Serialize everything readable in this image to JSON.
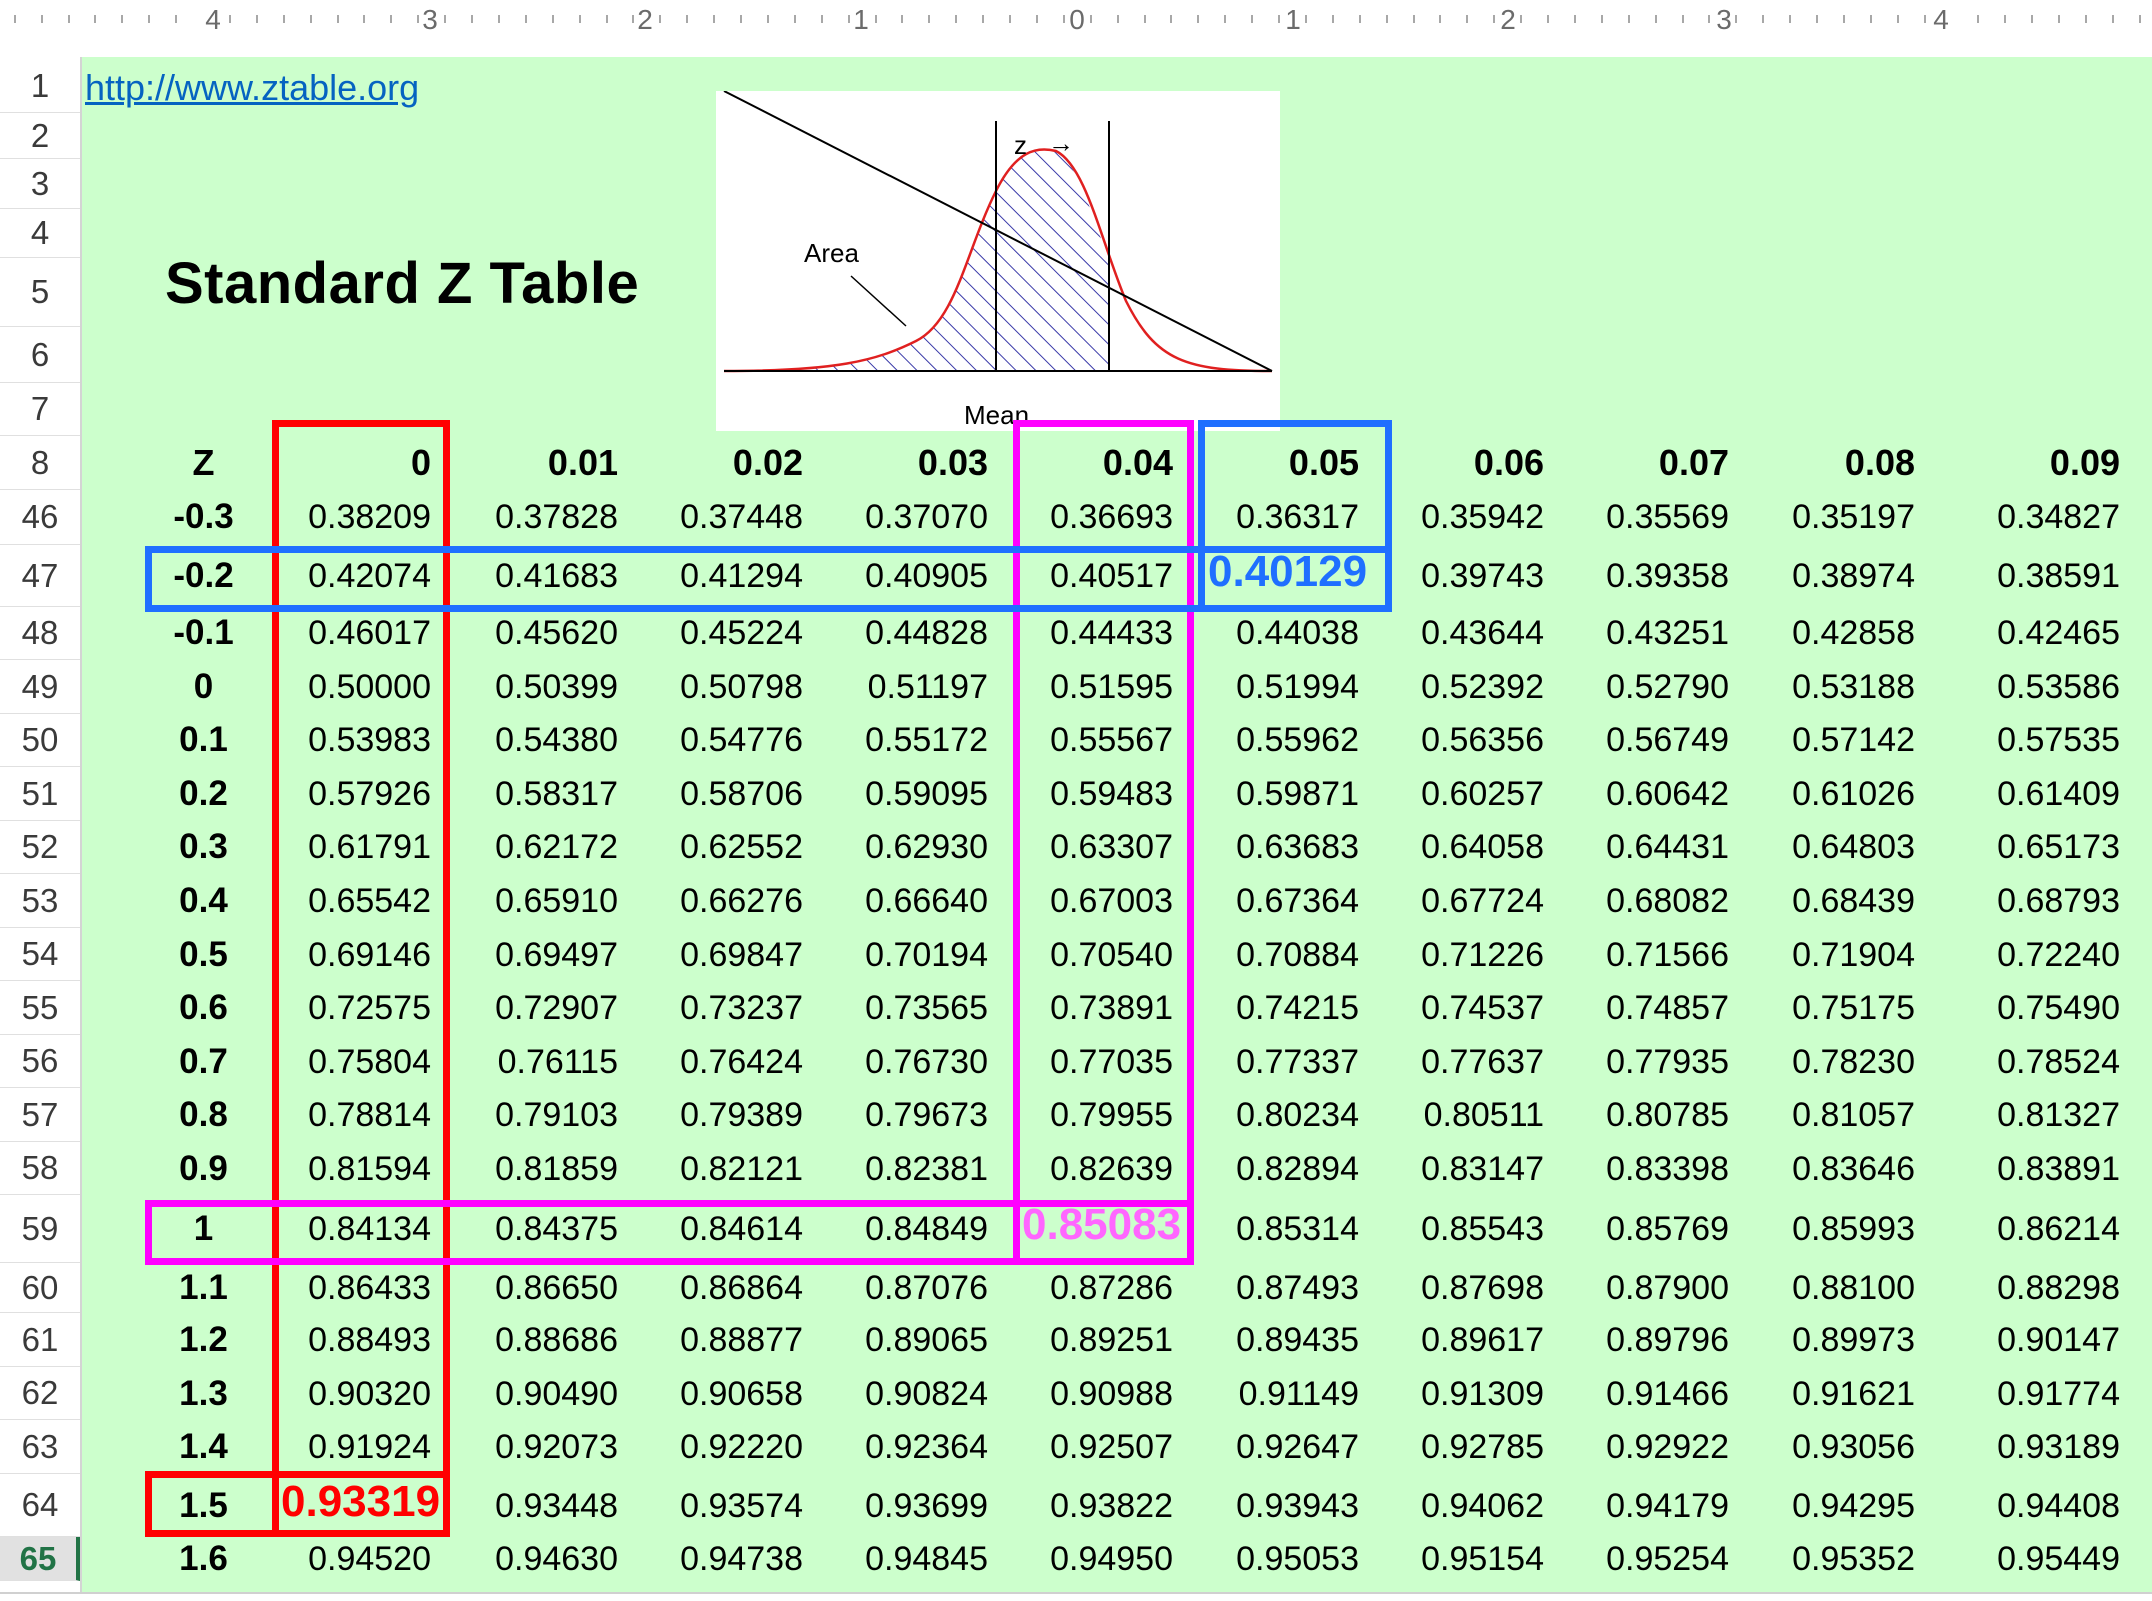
{
  "ruler": {
    "labels": [
      "4",
      "3",
      "2",
      "1",
      "0",
      "1",
      "2",
      "3",
      "4"
    ]
  },
  "link_text": "http://www.ztable.org",
  "title": "Standard Z Table",
  "figure": {
    "z_label": "z",
    "arrow": "→",
    "area_label": "Area",
    "mean_label": "Mean"
  },
  "colors": {
    "sheet_bg": "#ccffcc",
    "red_highlight": "#ff0000",
    "blue_highlight": "#1f6fff",
    "magenta_highlight": "#ff00ff",
    "pink_value": "#ff66ff",
    "link": "#0563c1"
  },
  "row_numbers": [
    "1",
    "2",
    "3",
    "4",
    "5",
    "6",
    "7",
    "8",
    "46",
    "47",
    "48",
    "49",
    "50",
    "51",
    "52",
    "53",
    "54",
    "55",
    "56",
    "57",
    "58",
    "59",
    "60",
    "61",
    "62",
    "63",
    "64",
    "65"
  ],
  "active_row": "65",
  "table": {
    "header_z": "Z",
    "columns": [
      "0",
      "0.01",
      "0.02",
      "0.03",
      "0.04",
      "0.05",
      "0.06",
      "0.07",
      "0.08",
      "0.09"
    ],
    "rows": [
      {
        "z": "-0.3",
        "values": [
          "0.38209",
          "0.37828",
          "0.37448",
          "0.37070",
          "0.36693",
          "0.36317",
          "0.35942",
          "0.35569",
          "0.35197",
          "0.34827"
        ]
      },
      {
        "z": "-0.2",
        "values": [
          "0.42074",
          "0.41683",
          "0.41294",
          "0.40905",
          "0.40517",
          "0.40129",
          "0.39743",
          "0.39358",
          "0.38974",
          "0.38591"
        ]
      },
      {
        "z": "-0.1",
        "values": [
          "0.46017",
          "0.45620",
          "0.45224",
          "0.44828",
          "0.44433",
          "0.44038",
          "0.43644",
          "0.43251",
          "0.42858",
          "0.42465"
        ]
      },
      {
        "z": "0",
        "values": [
          "0.50000",
          "0.50399",
          "0.50798",
          "0.51197",
          "0.51595",
          "0.51994",
          "0.52392",
          "0.52790",
          "0.53188",
          "0.53586"
        ]
      },
      {
        "z": "0.1",
        "values": [
          "0.53983",
          "0.54380",
          "0.54776",
          "0.55172",
          "0.55567",
          "0.55962",
          "0.56356",
          "0.56749",
          "0.57142",
          "0.57535"
        ]
      },
      {
        "z": "0.2",
        "values": [
          "0.57926",
          "0.58317",
          "0.58706",
          "0.59095",
          "0.59483",
          "0.59871",
          "0.60257",
          "0.60642",
          "0.61026",
          "0.61409"
        ]
      },
      {
        "z": "0.3",
        "values": [
          "0.61791",
          "0.62172",
          "0.62552",
          "0.62930",
          "0.63307",
          "0.63683",
          "0.64058",
          "0.64431",
          "0.64803",
          "0.65173"
        ]
      },
      {
        "z": "0.4",
        "values": [
          "0.65542",
          "0.65910",
          "0.66276",
          "0.66640",
          "0.67003",
          "0.67364",
          "0.67724",
          "0.68082",
          "0.68439",
          "0.68793"
        ]
      },
      {
        "z": "0.5",
        "values": [
          "0.69146",
          "0.69497",
          "0.69847",
          "0.70194",
          "0.70540",
          "0.70884",
          "0.71226",
          "0.71566",
          "0.71904",
          "0.72240"
        ]
      },
      {
        "z": "0.6",
        "values": [
          "0.72575",
          "0.72907",
          "0.73237",
          "0.73565",
          "0.73891",
          "0.74215",
          "0.74537",
          "0.74857",
          "0.75175",
          "0.75490"
        ]
      },
      {
        "z": "0.7",
        "values": [
          "0.75804",
          "0.76115",
          "0.76424",
          "0.76730",
          "0.77035",
          "0.77337",
          "0.77637",
          "0.77935",
          "0.78230",
          "0.78524"
        ]
      },
      {
        "z": "0.8",
        "values": [
          "0.78814",
          "0.79103",
          "0.79389",
          "0.79673",
          "0.79955",
          "0.80234",
          "0.80511",
          "0.80785",
          "0.81057",
          "0.81327"
        ]
      },
      {
        "z": "0.9",
        "values": [
          "0.81594",
          "0.81859",
          "0.82121",
          "0.82381",
          "0.82639",
          "0.82894",
          "0.83147",
          "0.83398",
          "0.83646",
          "0.83891"
        ]
      },
      {
        "z": "1",
        "values": [
          "0.84134",
          "0.84375",
          "0.84614",
          "0.84849",
          "0.85083",
          "0.85314",
          "0.85543",
          "0.85769",
          "0.85993",
          "0.86214"
        ]
      },
      {
        "z": "1.1",
        "values": [
          "0.86433",
          "0.86650",
          "0.86864",
          "0.87076",
          "0.87286",
          "0.87493",
          "0.87698",
          "0.87900",
          "0.88100",
          "0.88298"
        ]
      },
      {
        "z": "1.2",
        "values": [
          "0.88493",
          "0.88686",
          "0.88877",
          "0.89065",
          "0.89251",
          "0.89435",
          "0.89617",
          "0.89796",
          "0.89973",
          "0.90147"
        ]
      },
      {
        "z": "1.3",
        "values": [
          "0.90320",
          "0.90490",
          "0.90658",
          "0.90824",
          "0.90988",
          "0.91149",
          "0.91309",
          "0.91466",
          "0.91621",
          "0.91774"
        ]
      },
      {
        "z": "1.4",
        "values": [
          "0.91924",
          "0.92073",
          "0.92220",
          "0.92364",
          "0.92507",
          "0.92647",
          "0.92785",
          "0.92922",
          "0.93056",
          "0.93189"
        ]
      },
      {
        "z": "1.5",
        "values": [
          "0.93319",
          "0.93448",
          "0.93574",
          "0.93699",
          "0.93822",
          "0.93943",
          "0.94062",
          "0.94179",
          "0.94295",
          "0.94408"
        ]
      },
      {
        "z": "1.6",
        "values": [
          "0.94520",
          "0.94630",
          "0.94738",
          "0.94845",
          "0.94950",
          "0.95053",
          "0.95154",
          "0.95254",
          "0.95352",
          "0.95449"
        ]
      }
    ]
  },
  "highlights": {
    "blue": {
      "z": "-0.2",
      "column": "0.05",
      "value": "0.40129"
    },
    "magenta": {
      "z": "1",
      "column": "0.04",
      "value": "0.85083"
    },
    "red": {
      "z": "1.5",
      "column": "0",
      "value": "0.93319"
    }
  }
}
